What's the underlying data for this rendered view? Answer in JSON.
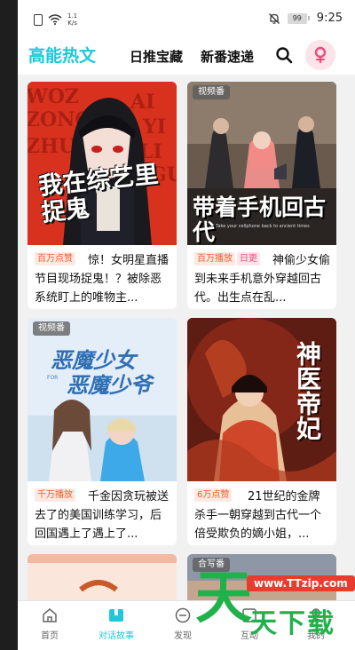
{
  "status": {
    "speed_value": "1.1",
    "speed_unit": "K/s",
    "battery": "99",
    "time": "9:25"
  },
  "header": {
    "tabs": [
      {
        "label": "高能热文",
        "active": true
      },
      {
        "label": "日推宝藏",
        "active": false
      },
      {
        "label": "新番速递",
        "active": false
      }
    ],
    "search_icon": "search-icon",
    "pin_icon": "location-pin-icon"
  },
  "cards": [
    {
      "badge": "",
      "cover_title": "我在综艺里捉鬼",
      "cover_letters": "WOZAI ZONG YI LI ZHUO GUI",
      "tags": [
        "百万点赞"
      ],
      "desc": "惊！女明星直播节目现场捉鬼！？被除恶系统盯上的唯物主..."
    },
    {
      "badge": "视频番",
      "cover_title": "带着手机回古代",
      "cover_subtitle": "Take your cellphone back to ancient times",
      "tags": [
        "百万播放",
        "日更"
      ],
      "desc": "神偷少女偷到未来手机意外穿越回古代。出生点在乱..."
    },
    {
      "badge": "视频番",
      "cover_title_1": "恶魔少女",
      "cover_title_2": "恶魔少爷",
      "cover_title_for": "FOR",
      "tags": [
        "千万播放"
      ],
      "desc": "千金因贪玩被送去了的美国训练学习，后回国遇上了遇上了..."
    },
    {
      "badge": "",
      "cover_title": "神医帝妃",
      "tags": [
        "6万点赞"
      ],
      "desc": "21世纪的金牌杀手一朝穿越到古代一个倍受欺负的嫡小姐，..."
    },
    {
      "badge": "",
      "cover_title": "",
      "tags": [],
      "desc": ""
    },
    {
      "badge": "合写番",
      "cover_title": "",
      "tags": [],
      "desc": ""
    }
  ],
  "nav": [
    {
      "label": "首页",
      "icon": "home-icon",
      "active": false
    },
    {
      "label": "对话故事",
      "icon": "chat-story-icon",
      "active": true
    },
    {
      "label": "发现",
      "icon": "discover-icon",
      "active": false
    },
    {
      "label": "互动",
      "icon": "interact-icon",
      "active": false
    },
    {
      "label": "我的",
      "icon": "profile-icon",
      "active": false
    }
  ],
  "watermark": {
    "url": "www.TTzip.com",
    "big": "天",
    "small": "天下载"
  },
  "colors": {
    "accent": "#1ec8d8",
    "tag_hot": "#f05a28",
    "tag_pink": "#e8507a"
  }
}
